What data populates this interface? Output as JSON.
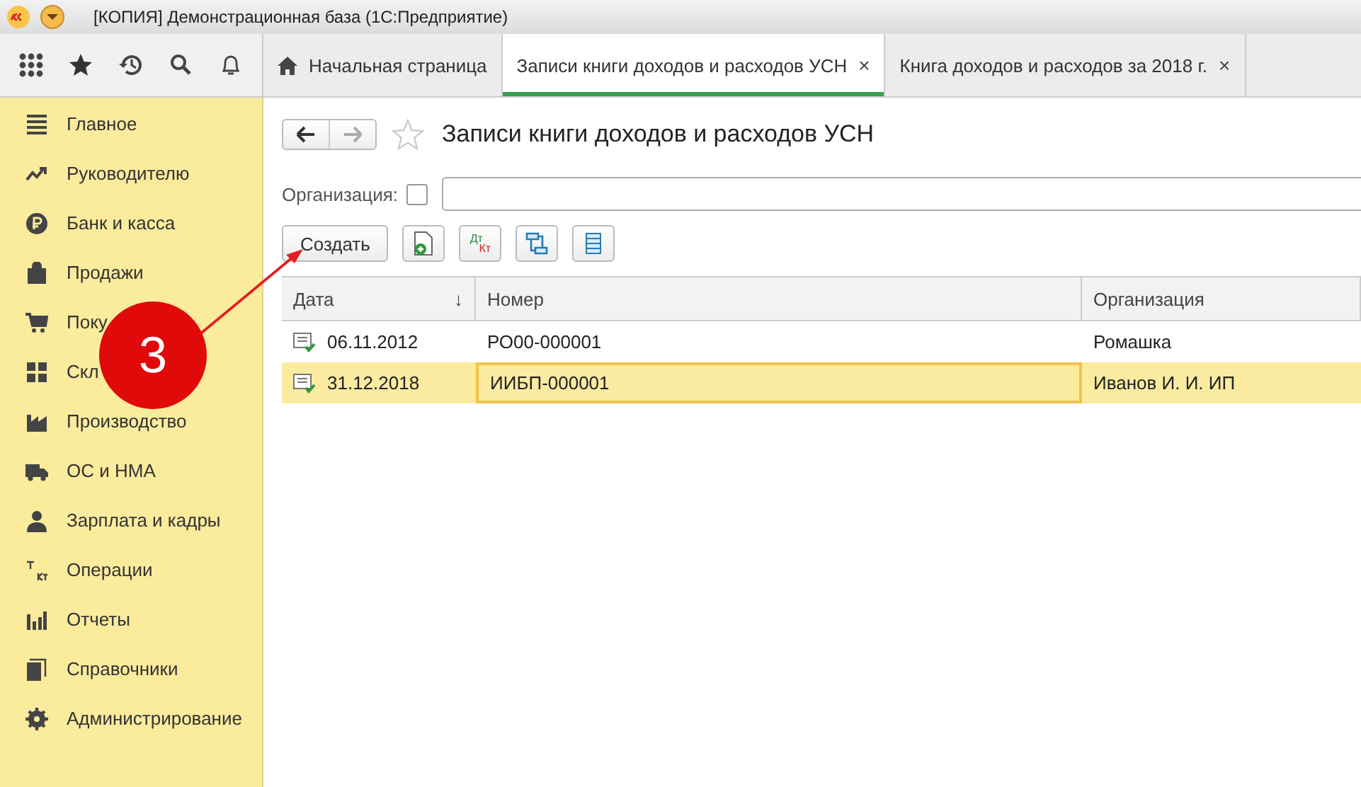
{
  "window": {
    "title": "[КОПИЯ] Демонстрационная база  (1С:Предприятие)"
  },
  "tabs": [
    {
      "label": "Начальная страница",
      "kind": "home",
      "selected": false
    },
    {
      "label": "Записи книги доходов и расходов УСН",
      "kind": "doc",
      "close": "×",
      "selected": true
    },
    {
      "label": "Книга доходов и расходов за 2018 г.",
      "kind": "doc",
      "close": "×",
      "selected": false
    }
  ],
  "sidebar": {
    "items": [
      {
        "label": "Главное",
        "kind": "menu"
      },
      {
        "label": "Руководителю",
        "kind": "trend"
      },
      {
        "label": "Банк и касса",
        "kind": "ruble"
      },
      {
        "label": "Продажи",
        "kind": "bag"
      },
      {
        "label": "Поку",
        "kind": "cart"
      },
      {
        "label": "Скл",
        "kind": "grid"
      },
      {
        "label": "Производство",
        "kind": "factory"
      },
      {
        "label": "ОС и НМА",
        "kind": "truck"
      },
      {
        "label": "Зарплата и кадры",
        "kind": "person"
      },
      {
        "label": "Операции",
        "kind": "dtkt"
      },
      {
        "label": "Отчеты",
        "kind": "bars"
      },
      {
        "label": "Справочники",
        "kind": "books"
      },
      {
        "label": "Администрирование",
        "kind": "gear"
      }
    ]
  },
  "form": {
    "title": "Записи книги доходов и расходов УСН",
    "filter": {
      "label": "Организация:",
      "checked": false
    },
    "create_button": "Создать",
    "icon_buttons": [
      {
        "kind": "add"
      },
      {
        "kind": "dtkt",
        "top": "Дт",
        "bottom": "Кт"
      },
      {
        "kind": "struct"
      },
      {
        "kind": "list"
      }
    ]
  },
  "table": {
    "columns": [
      {
        "label": "Дата",
        "sort": "↓"
      },
      {
        "label": "Номер"
      },
      {
        "label": "Организация"
      }
    ],
    "rows": [
      {
        "cells": [
          "06.11.2012",
          "РО00-000001",
          "Ромашка"
        ],
        "selected": false
      },
      {
        "cells": [
          "31.12.2018",
          "ИИБП-000001",
          "Иванов И. И. ИП"
        ],
        "selected": true
      }
    ]
  },
  "callout": {
    "label": "3"
  }
}
